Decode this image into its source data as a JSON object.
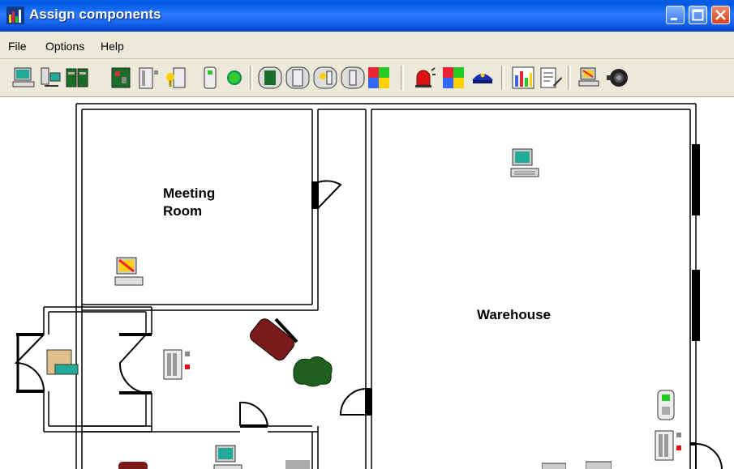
{
  "window": {
    "title": "Assign components",
    "title_icon": "bar-chart-icon"
  },
  "menu": {
    "items": [
      {
        "label": "File"
      },
      {
        "label": "Options"
      },
      {
        "label": "Help"
      }
    ]
  },
  "toolbar": {
    "tools": [
      "workstation-icon",
      "network-computers-icon",
      "server-rack-icon",
      "circuit-board-icon",
      "door-controller-icon",
      "keypad-reader-icon",
      "card-reader-icon",
      "green-indicator-icon",
      "board-device-icon",
      "door-device-icon",
      "keypad-device-icon",
      "reader-device-icon",
      "puzzle-icon",
      "alarm-siren-icon",
      "map-puzzle-icon",
      "security-guard-icon",
      "report-chart-icon",
      "document-pen-icon",
      "monitor-station-icon",
      "camera-icon"
    ]
  },
  "floorplan": {
    "rooms": [
      {
        "label": "Meeting\nRoom"
      },
      {
        "label": "Warehouse"
      }
    ]
  },
  "colors": {
    "titlebar": "#0058e6",
    "menubar": "#ece9d8",
    "furniture": "#7a1a1a",
    "plant": "#1f5f1f",
    "door_wall": "#000000"
  }
}
